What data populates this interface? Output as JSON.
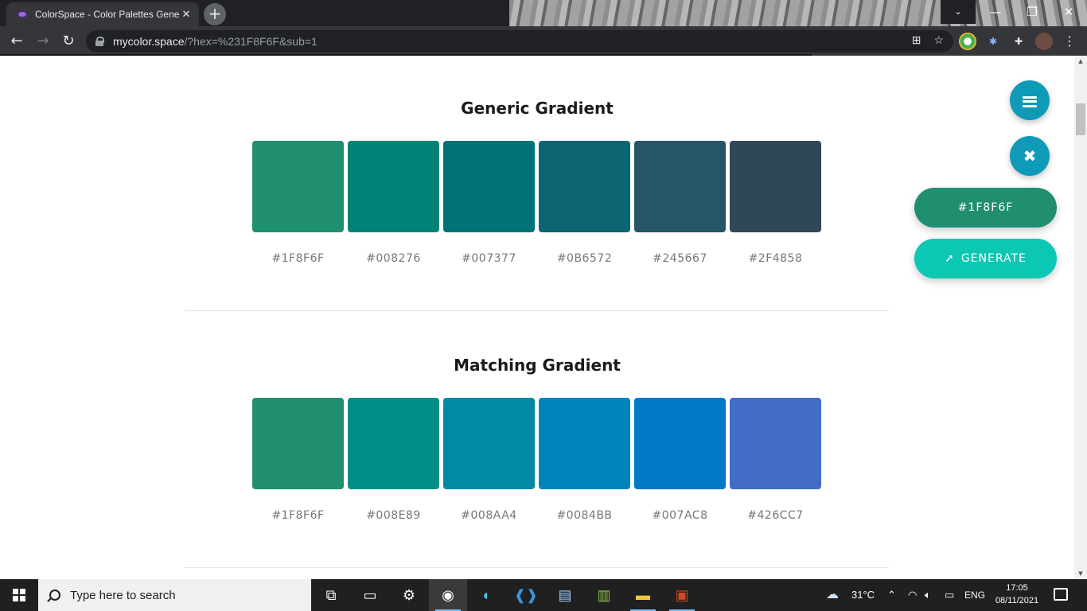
{
  "browser": {
    "tab_title": "ColorSpace - Color Palettes Gene",
    "tab_close": "✕",
    "new_tab": "+",
    "url_host": "mycolor.space",
    "url_rest": "/?hex=%231F8F6F&sub=1",
    "window_controls": {
      "dropdown": "⌄",
      "minimize": "—",
      "maximize": "❐",
      "close": "✕"
    }
  },
  "sections": [
    {
      "title": "Generic Gradient",
      "swatches": [
        {
          "hex": "#1F8F6F",
          "color": "#1F8F6F"
        },
        {
          "hex": "#008276",
          "color": "#008276"
        },
        {
          "hex": "#007377",
          "color": "#007377"
        },
        {
          "hex": "#0B6572",
          "color": "#0B6572"
        },
        {
          "hex": "#245667",
          "color": "#245667"
        },
        {
          "hex": "#2F4858",
          "color": "#2F4858"
        }
      ]
    },
    {
      "title": "Matching Gradient",
      "swatches": [
        {
          "hex": "#1F8F6F",
          "color": "#1F8F6F"
        },
        {
          "hex": "#008E89",
          "color": "#008E89"
        },
        {
          "hex": "#008AA4",
          "color": "#008AA4"
        },
        {
          "hex": "#0084BB",
          "color": "#0084BB"
        },
        {
          "hex": "#007AC8",
          "color": "#007AC8"
        },
        {
          "hex": "#426CC7",
          "color": "#426CC7"
        }
      ]
    }
  ],
  "controls": {
    "hex_value": "#1F8F6F",
    "generate_label": "GENERATE",
    "close_glyph": "✖"
  },
  "taskbar": {
    "search_placeholder": "Type here to search",
    "weather": "31°C",
    "language": "ENG",
    "time": "17:05",
    "date": "08/11/2021"
  },
  "colors": {
    "accent": "#0F9AB8",
    "hex_pill": "#1F8F6F",
    "generate": "#0BC7B4"
  }
}
